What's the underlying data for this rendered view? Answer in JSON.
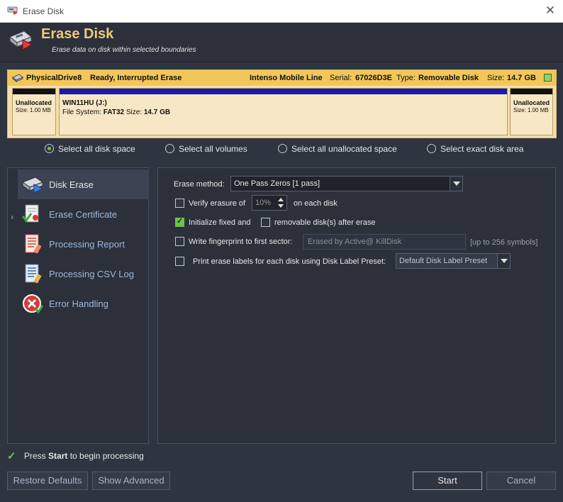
{
  "window": {
    "title": "Erase Disk",
    "close_glyph": "✕"
  },
  "header": {
    "title": "Erase Disk",
    "subtitle": "Erase data on disk within selected boundaries"
  },
  "disk": {
    "name": "PhysicalDrive8",
    "status": "Ready, Interrupted Erase",
    "model": "Intenso Mobile Line",
    "serial_label": "Serial:",
    "serial": "67026D3E",
    "type_label": "Type:",
    "type": "Removable Disk",
    "size_label": "Size:",
    "size": "14.7 GB",
    "colors": {
      "header": "#f2c75a",
      "partition_bar": "#1a1aa8",
      "unalloc_bar": "#111111"
    },
    "partitions": [
      {
        "name": "Unallocated",
        "info": "Size: 1.00 MB"
      },
      {
        "name": "WIN11HU (J:)",
        "fs_label": "File System:",
        "fs": "FAT32",
        "size_label": "Size:",
        "size": "14.7 GB"
      },
      {
        "name": "Unallocated",
        "info": "Size: 1.00 MB"
      }
    ]
  },
  "selection": {
    "options": [
      "Select all disk space",
      "Select all volumes",
      "Select all unallocated space",
      "Select exact disk area"
    ],
    "selected": 0
  },
  "nav": {
    "items": [
      {
        "label": "Disk Erase",
        "icon": "disk-erase-icon"
      },
      {
        "label": "Erase Certificate",
        "icon": "certificate-icon"
      },
      {
        "label": "Processing Report",
        "icon": "report-icon"
      },
      {
        "label": "Processing CSV Log",
        "icon": "csv-log-icon"
      },
      {
        "label": "Error Handling",
        "icon": "error-icon"
      }
    ],
    "active": 0
  },
  "options": {
    "erase_method_label": "Erase method:",
    "erase_method_value": "One Pass Zeros [1 pass]",
    "verify_label": "Verify erasure of",
    "verify_value": "10%",
    "verify_suffix": "on each disk",
    "verify_checked": false,
    "init_fixed_label": "Initialize fixed and",
    "init_fixed_checked": true,
    "init_removable_label": "removable disk(s) after erase",
    "init_removable_checked": false,
    "fingerprint_label": "Write fingerprint to first sector:",
    "fingerprint_placeholder": "Erased by Active@ KillDisk",
    "fingerprint_hint": "[up to 256 symbols]",
    "fingerprint_checked": false,
    "labels_label": "Print erase labels for each disk using Disk Label Preset:",
    "labels_preset": "Default Disk Label Preset",
    "labels_checked": false
  },
  "footer": {
    "status_prefix": "Press ",
    "status_bold": "Start",
    "status_suffix": " to begin processing",
    "restore_defaults": "Restore Defaults",
    "show_advanced": "Show Advanced",
    "start": "Start",
    "cancel": "Cancel"
  }
}
